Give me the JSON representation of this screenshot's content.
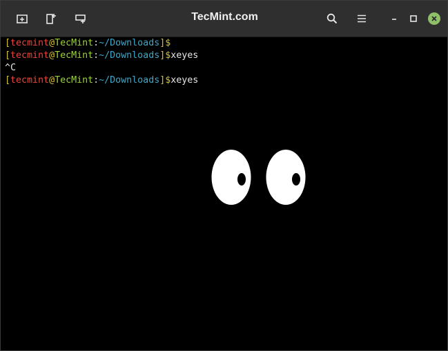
{
  "window": {
    "title": "TecMint.com"
  },
  "toolbar": {
    "icons": [
      "new-tab-icon",
      "split-terminal-icon",
      "add-session-icon",
      "search-icon",
      "menu-icon",
      "minimize-icon",
      "maximize-icon",
      "close-icon"
    ]
  },
  "prompt": {
    "open_bracket": "[",
    "user": "tecmint",
    "at": "@",
    "host": "TecMint",
    "colon": ":",
    "path": "~/Downloads",
    "close_bracket": "]",
    "dollar": "$"
  },
  "terminal": {
    "lines": [
      {
        "type": "prompt",
        "command": ""
      },
      {
        "type": "prompt",
        "command": "xeyes"
      },
      {
        "type": "output",
        "text": "^C"
      },
      {
        "type": "prompt",
        "command": "xeyes"
      }
    ]
  },
  "colors": {
    "titlebar": "#2f2f2f",
    "terminal_bg": "#000000",
    "user": "#e8453c",
    "host": "#9bd33a",
    "path": "#3fa8c8",
    "bracket": "#d4c02c",
    "close_button": "#8fbf69"
  }
}
